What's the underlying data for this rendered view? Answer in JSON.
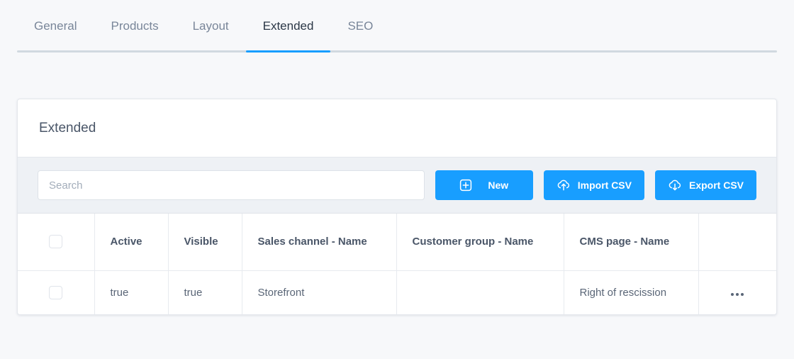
{
  "tabs": [
    {
      "label": "General",
      "active": false
    },
    {
      "label": "Products",
      "active": false
    },
    {
      "label": "Layout",
      "active": false
    },
    {
      "label": "Extended",
      "active": true
    },
    {
      "label": "SEO",
      "active": false
    }
  ],
  "card": {
    "title": "Extended"
  },
  "toolbar": {
    "search_placeholder": "Search",
    "search_value": "",
    "new_label": "New",
    "import_label": "Import CSV",
    "export_label": "Export CSV",
    "new_icon": "plus-square-icon",
    "import_icon": "cloud-upload-icon",
    "export_icon": "cloud-download-icon"
  },
  "table": {
    "columns": [
      "",
      "Active",
      "Visible",
      "Sales channel - Name",
      "Customer group - Name",
      "CMS page - Name",
      ""
    ],
    "rows": [
      {
        "active": "true",
        "visible": "true",
        "sales_channel": "Storefront",
        "customer_group": "",
        "cms_page": "Right of rescission"
      }
    ]
  },
  "colors": {
    "accent": "#189eff",
    "page_bg": "#f7f8fa",
    "toolbar_bg": "#eef1f5",
    "text": "#4a5668",
    "muted_text": "#798699",
    "border": "#e4e7ec"
  }
}
